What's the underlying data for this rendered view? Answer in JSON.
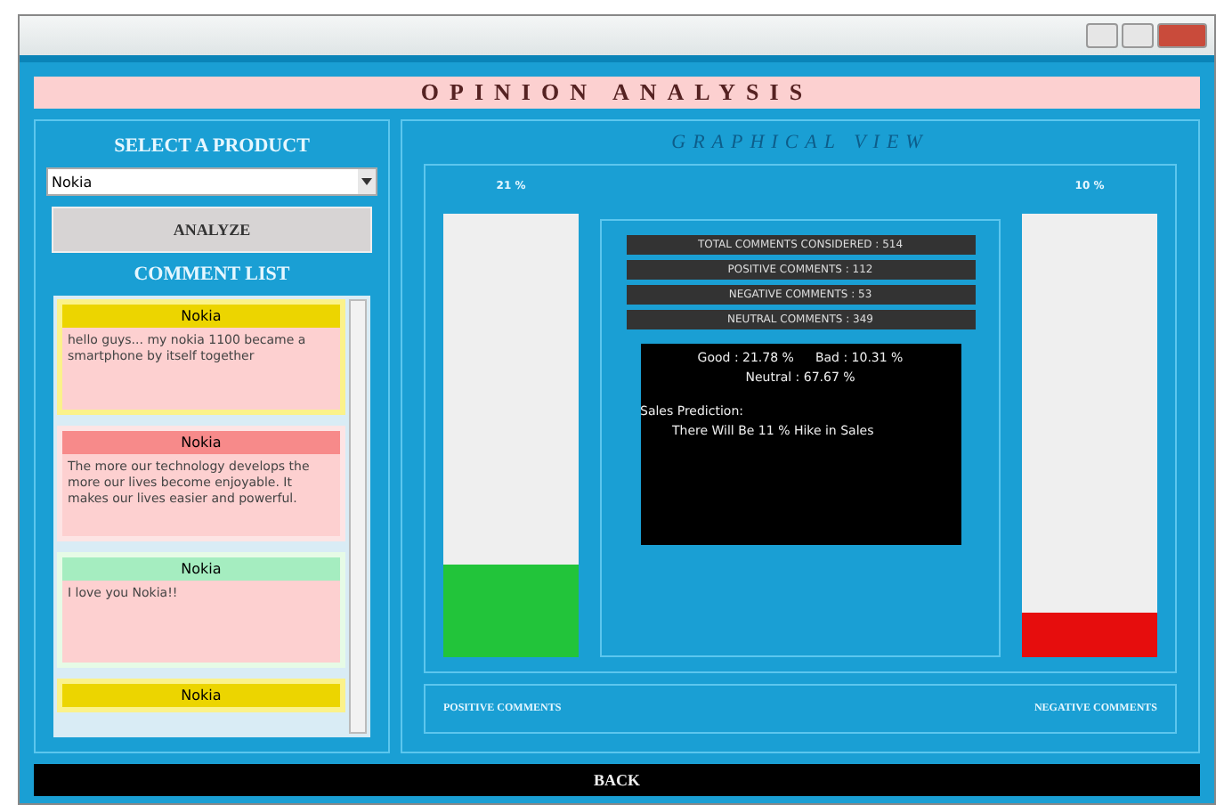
{
  "header": {
    "title": "OPINION ANALYSIS"
  },
  "sidebar": {
    "select_label": "SELECT A PRODUCT",
    "product": "Nokia",
    "analyze_button": "ANALYZE",
    "list_title": "COMMENT LIST",
    "comments": [
      {
        "kind": "neutral",
        "product": "Nokia",
        "text": "hello guys... my nokia 1100 became a smartphone by itself together"
      },
      {
        "kind": "negative",
        "product": "Nokia",
        "text": "The more our technology develops the more our lives become enjoyable. It makes our lives easier and powerful."
      },
      {
        "kind": "positive",
        "product": "Nokia",
        "text": "I love you Nokia!!"
      },
      {
        "kind": "neutral",
        "product": "Nokia"
      }
    ]
  },
  "graph": {
    "title": "GRAPHICAL VIEW",
    "positive_bar": {
      "reading": "21 %",
      "level": 0.21
    },
    "negative_bar": {
      "reading": "10 %",
      "level": 0.1
    },
    "stats": [
      "TOTAL COMMENTS CONSIDERED : 514",
      "POSITIVE COMMENTS : 112",
      "NEGATIVE COMMENTS : 53",
      "NEUTRAL COMMENTS : 349"
    ],
    "result": {
      "good": "Good : 21.78 %",
      "bad": "Bad : 10.31 %",
      "neutral": "Neutral : 67.67  %",
      "prediction_label": "Sales Prediction:",
      "prediction": "There Will Be 11 % Hike in Sales"
    },
    "legend_positive": "POSITIVE COMMENTS",
    "legend_negative": "NEGATIVE COMMENTS"
  },
  "back_button": "BACK"
}
